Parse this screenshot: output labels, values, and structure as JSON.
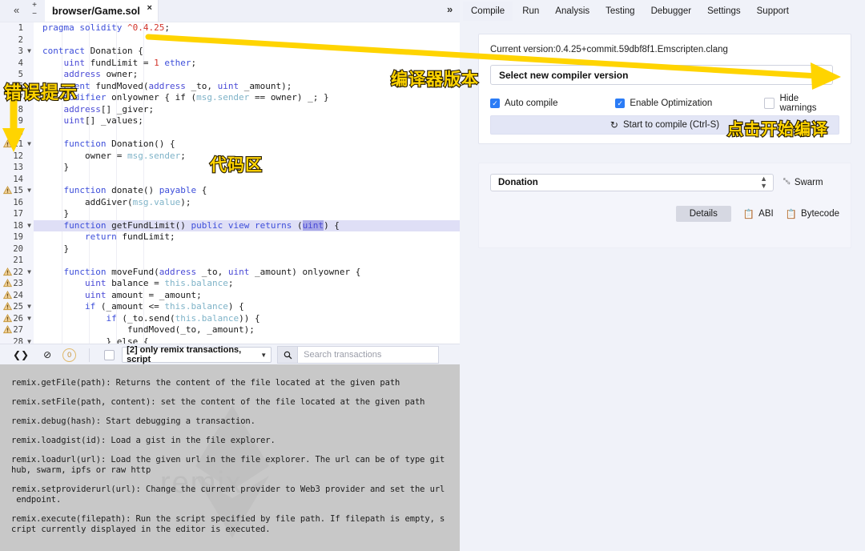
{
  "window": {
    "tab_bar": {
      "collapse_icon": "«",
      "zoom_in": "+",
      "zoom_out": "−",
      "file_tab": "browser/Game.sol",
      "close_icon": "×",
      "expand_icon": "»"
    },
    "nav_tabs": [
      {
        "label": "Compile",
        "active": true
      },
      {
        "label": "Run",
        "active": false
      },
      {
        "label": "Analysis",
        "active": false
      },
      {
        "label": "Testing",
        "active": false
      },
      {
        "label": "Debugger",
        "active": false
      },
      {
        "label": "Settings",
        "active": false
      },
      {
        "label": "Support",
        "active": false
      }
    ]
  },
  "editor": {
    "lines": [
      {
        "n": 1,
        "warn": false,
        "fold": false,
        "html": "<span class='kw'>pragma</span> <span class='kw'>solidity</span> <span class='num'>^0.4.25</span><span class='plain'>;</span>",
        "indent": 0
      },
      {
        "n": 2,
        "warn": false,
        "fold": false,
        "html": "",
        "indent": 0
      },
      {
        "n": 3,
        "warn": false,
        "fold": true,
        "html": "<span class='kw'>contract</span> <span class='plain'>Donation</span> <span class='plain'>{</span>",
        "indent": 0
      },
      {
        "n": 4,
        "warn": false,
        "fold": false,
        "html": "&nbsp;&nbsp;&nbsp;&nbsp;<span class='typ'>uint</span> <span class='plain'>fundLimit</span> <span class='plain'>=</span> <span class='num'>1</span> <span class='kw'>ether</span><span class='plain'>;</span>",
        "indent": 1
      },
      {
        "n": 5,
        "warn": false,
        "fold": false,
        "html": "&nbsp;&nbsp;&nbsp;&nbsp;<span class='typ'>address</span> <span class='plain'>owner;</span>",
        "indent": 1
      },
      {
        "n": 6,
        "warn": false,
        "fold": false,
        "html": "&nbsp;&nbsp;&nbsp;&nbsp;<span class='kw'>event</span> <span class='plain'>fundMoved(</span><span class='typ'>address</span> <span class='plain'>_to,</span> <span class='typ'>uint</span> <span class='plain'>_amount);</span>",
        "indent": 1
      },
      {
        "n": 7,
        "warn": false,
        "fold": false,
        "html": "&nbsp;&nbsp;&nbsp;&nbsp;<span class='kw'>modifier</span> <span class='plain'>onlyowner { if (</span><span class='glob'>msg.sender</span> <span class='plain'>==</span> <span class='plain'>owner) _; }</span>",
        "indent": 1
      },
      {
        "n": 8,
        "warn": false,
        "fold": false,
        "html": "&nbsp;&nbsp;&nbsp;&nbsp;<span class='typ'>address</span><span class='plain'>[] _giver;</span>",
        "indent": 1
      },
      {
        "n": 9,
        "warn": false,
        "fold": false,
        "html": "&nbsp;&nbsp;&nbsp;&nbsp;<span class='typ'>uint</span><span class='plain'>[] _values;</span>",
        "indent": 1
      },
      {
        "n": 10,
        "warn": false,
        "fold": false,
        "html": "",
        "indent": 1
      },
      {
        "n": 11,
        "warn": true,
        "fold": true,
        "html": "&nbsp;&nbsp;&nbsp;&nbsp;<span class='kw'>function</span> <span class='plain'>Donation() {</span>",
        "indent": 1
      },
      {
        "n": 12,
        "warn": false,
        "fold": false,
        "html": "&nbsp;&nbsp;&nbsp;&nbsp;&nbsp;&nbsp;&nbsp;&nbsp;<span class='plain'>owner</span> <span class='plain'>=</span> <span class='glob'>msg.sender</span><span class='plain'>;</span>",
        "indent": 2
      },
      {
        "n": 13,
        "warn": false,
        "fold": false,
        "html": "&nbsp;&nbsp;&nbsp;&nbsp;<span class='plain'>}</span>",
        "indent": 1
      },
      {
        "n": 14,
        "warn": false,
        "fold": false,
        "html": "",
        "indent": 1
      },
      {
        "n": 15,
        "warn": true,
        "fold": true,
        "html": "&nbsp;&nbsp;&nbsp;&nbsp;<span class='kw'>function</span> <span class='plain'>donate()</span> <span class='kw'>payable</span> <span class='plain'>{</span>",
        "indent": 1
      },
      {
        "n": 16,
        "warn": false,
        "fold": false,
        "html": "&nbsp;&nbsp;&nbsp;&nbsp;&nbsp;&nbsp;&nbsp;&nbsp;<span class='plain'>addGiver(</span><span class='glob'>msg.value</span><span class='plain'>);</span>",
        "indent": 2
      },
      {
        "n": 17,
        "warn": false,
        "fold": false,
        "html": "&nbsp;&nbsp;&nbsp;&nbsp;<span class='plain'>}</span>",
        "indent": 1
      },
      {
        "n": 18,
        "warn": false,
        "fold": true,
        "html": "&nbsp;&nbsp;&nbsp;&nbsp;<span class='kw'>function</span> <span class='plain'>getFundLimit()</span> <span class='kw'>public</span> <span class='kw'>view</span> <span class='kw'>returns</span> <span class='plain'>(</span><span class='typ sel'>uint</span><span class='plain'>) {</span>",
        "indent": 1,
        "highlight": true
      },
      {
        "n": 19,
        "warn": false,
        "fold": false,
        "html": "&nbsp;&nbsp;&nbsp;&nbsp;&nbsp;&nbsp;&nbsp;&nbsp;<span class='kw'>return</span> <span class='plain'>fundLimit;</span>",
        "indent": 2
      },
      {
        "n": 20,
        "warn": false,
        "fold": false,
        "html": "&nbsp;&nbsp;&nbsp;&nbsp;<span class='plain'>}</span>",
        "indent": 1
      },
      {
        "n": 21,
        "warn": false,
        "fold": false,
        "html": "",
        "indent": 1
      },
      {
        "n": 22,
        "warn": true,
        "fold": true,
        "html": "&nbsp;&nbsp;&nbsp;&nbsp;<span class='kw'>function</span> <span class='plain'>moveFund(</span><span class='typ'>address</span> <span class='plain'>_to,</span> <span class='typ'>uint</span> <span class='plain'>_amount) onlyowner {</span>",
        "indent": 1
      },
      {
        "n": 23,
        "warn": true,
        "fold": false,
        "html": "&nbsp;&nbsp;&nbsp;&nbsp;&nbsp;&nbsp;&nbsp;&nbsp;<span class='typ'>uint</span> <span class='plain'>balance</span> <span class='plain'>=</span> <span class='glob'>this.balance</span><span class='plain'>;</span>",
        "indent": 2
      },
      {
        "n": 24,
        "warn": true,
        "fold": false,
        "html": "&nbsp;&nbsp;&nbsp;&nbsp;&nbsp;&nbsp;&nbsp;&nbsp;<span class='typ'>uint</span> <span class='plain'>amount = _amount;</span>",
        "indent": 2
      },
      {
        "n": 25,
        "warn": true,
        "fold": true,
        "html": "&nbsp;&nbsp;&nbsp;&nbsp;&nbsp;&nbsp;&nbsp;&nbsp;<span class='kw'>if</span> <span class='plain'>(_amount &lt;=</span> <span class='glob'>this.balance</span><span class='plain'>) {</span>",
        "indent": 2
      },
      {
        "n": 26,
        "warn": true,
        "fold": true,
        "html": "&nbsp;&nbsp;&nbsp;&nbsp;&nbsp;&nbsp;&nbsp;&nbsp;&nbsp;&nbsp;&nbsp;&nbsp;<span class='kw'>if</span> <span class='plain'>(_to.send(</span><span class='glob'>this.balance</span><span class='plain'>)) {</span>",
        "indent": 3
      },
      {
        "n": 27,
        "warn": true,
        "fold": false,
        "html": "&nbsp;&nbsp;&nbsp;&nbsp;&nbsp;&nbsp;&nbsp;&nbsp;&nbsp;&nbsp;&nbsp;&nbsp;&nbsp;&nbsp;&nbsp;&nbsp;<span class='plain'>fundMoved(_to, _amount);</span>",
        "indent": 4
      },
      {
        "n": 28,
        "warn": false,
        "fold": true,
        "html": "&nbsp;&nbsp;&nbsp;&nbsp;&nbsp;&nbsp;&nbsp;&nbsp;&nbsp;&nbsp;&nbsp;&nbsp;<span class='plain'>} else {</span>",
        "indent": 3
      }
    ]
  },
  "terminal": {
    "toolbar": {
      "collapse_icon": "chevron-down",
      "clear_icon": "no-entry",
      "pending_count": "0",
      "checkbox_checked": false,
      "filter_label": "[2] only remix transactions, script",
      "filter_caret": "▼",
      "search_icon": "Q",
      "search_placeholder": "Search transactions"
    },
    "console_lines": [
      "remix.getFile(path): Returns the content of the file located at the given path",
      "remix.setFile(path, content): set the content of the file located at the given path",
      "remix.debug(hash): Start debugging a transaction.",
      "remix.loadgist(id): Load a gist in the file explorer.",
      "remix.loadurl(url): Load the given url in the file explorer. The url can be of type git\nhub, swarm, ipfs or raw http",
      "remix.setproviderurl(url): Change the current provider to Web3 provider and set the url\n endpoint.",
      "remix.execute(filepath): Run the script specified by file path. If filepath is empty, s\ncript currently displayed in the editor is executed."
    ],
    "watermark": "remix"
  },
  "compile_panel": {
    "current_version": "Current version:0.4.25+commit.59dbf8f1.Emscripten.clang",
    "version_select": "Select new compiler version",
    "options": [
      {
        "label": "Auto compile",
        "checked": true
      },
      {
        "label": "Enable Optimization",
        "checked": true
      },
      {
        "label": "Hide warnings",
        "checked": false
      }
    ],
    "compile_button": "Start to compile (Ctrl-S)",
    "refresh_icon": "↻"
  },
  "contract_panel": {
    "selected_contract": "Donation",
    "swarm_label": "Swarm",
    "details_label": "Details",
    "abi_label": "ABI",
    "bytecode_label": "Bytecode"
  },
  "annotations": {
    "error_hint": "错误提示",
    "code_area": "代码区",
    "compiler_version": "编译器版本",
    "click_compile": "点击开始编译",
    "arrow_color": "#ffd400",
    "text_color": "#ffd400",
    "stroke_color": "#241a00"
  }
}
